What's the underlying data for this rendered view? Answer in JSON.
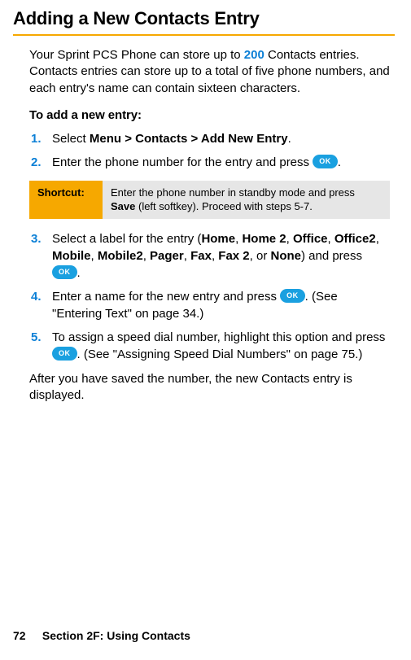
{
  "title": "Adding a New Contacts Entry",
  "intro": {
    "pre": "Your Sprint PCS Phone can store up to ",
    "highlight": "200",
    "post": " Contacts entries. Contacts entries can store up to a total of five phone numbers, and each entry's name can contain sixteen characters."
  },
  "subhead": "To add a new entry:",
  "ok_label": "OK",
  "steps": {
    "s1": {
      "num": "1.",
      "pre": "Select ",
      "menu": "Menu",
      "gt1": " > ",
      "contacts": "Contacts",
      "gt2": " > ",
      "add": "Add New Entry",
      "post": "."
    },
    "s2": {
      "num": "2.",
      "text": "Enter the phone number for the entry and press ",
      "post": "."
    },
    "s3": {
      "num": "3.",
      "pre": "Select a label for the entry (",
      "labels": [
        "Home",
        "Home 2",
        "Office",
        "Office2",
        "Mobile",
        "Mobile2",
        "Pager",
        "Fax",
        "Fax 2",
        "None"
      ],
      "mid": ") and press ",
      "post": "."
    },
    "s4": {
      "num": "4.",
      "pre": "Enter a name for the new entry and press ",
      "post": ". (See \"Entering Text\" on page 34.)"
    },
    "s5": {
      "num": "5.",
      "pre": "To assign a speed dial number, highlight this option and press ",
      "post": ". (See \"Assigning Speed Dial Numbers\" on page 75.)"
    }
  },
  "shortcut": {
    "label": "Shortcut:",
    "pre": "Enter the phone number in standby mode and press ",
    "bold": "Save",
    "post": " (left softkey). Proceed with steps 5-7."
  },
  "after": "After you have saved the number, the new Contacts entry is displayed.",
  "footer": {
    "page": "72",
    "section": "Section 2F: Using Contacts"
  }
}
